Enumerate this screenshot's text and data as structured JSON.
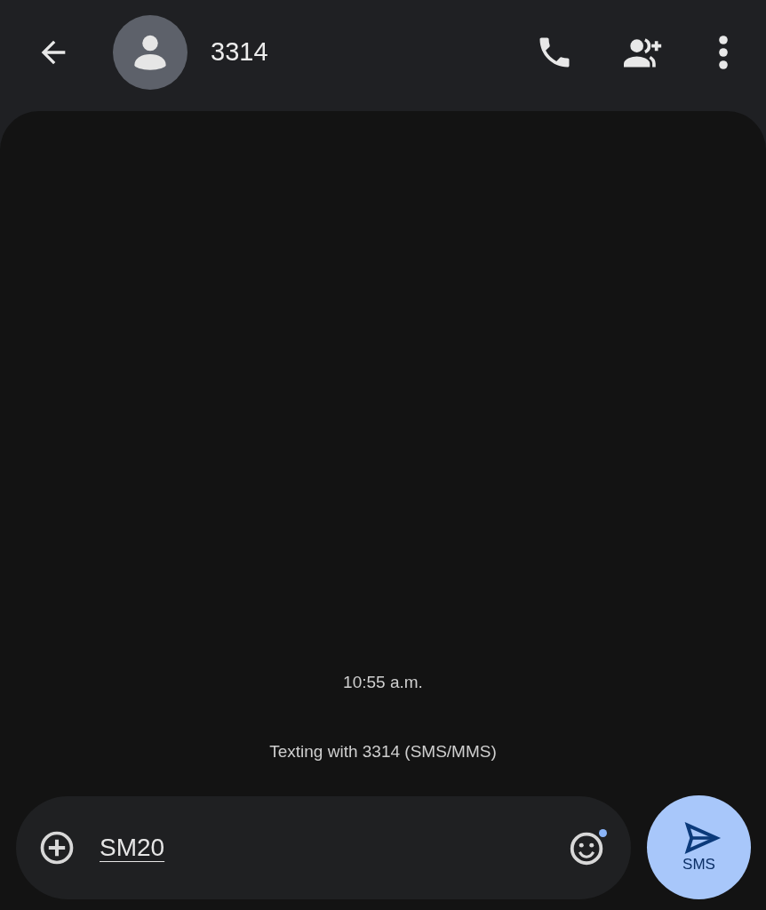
{
  "header": {
    "contact_name": "3314"
  },
  "conversation": {
    "timestamp": "10:55 a.m.",
    "info": "Texting with 3314 (SMS/MMS)"
  },
  "composer": {
    "value": "SM20",
    "emoji_badge": true,
    "send_label": "SMS"
  }
}
